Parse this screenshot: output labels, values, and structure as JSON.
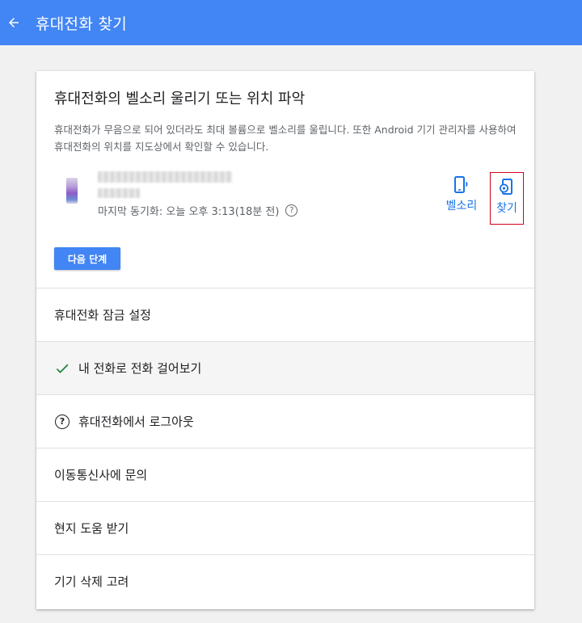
{
  "header": {
    "title": "휴대전화 찾기",
    "back_icon": "arrow-back-icon"
  },
  "card": {
    "heading": "휴대전화의 벨소리 울리기 또는 위치 파악",
    "description": "휴대전화가 무음으로 되어 있더라도 최대 볼륨으로 벨소리를 울립니다. 또한 Android 기기 관리자를 사용하여 휴대전화의 위치를 지도상에서 확인할 수 있습니다."
  },
  "device": {
    "last_sync": "마지막 동기화: 오늘 오후 3:13(18분 전)",
    "help_glyph": "?"
  },
  "actions": {
    "ring_label": "벨소리",
    "find_label": "찾기"
  },
  "next_button": "다음 단계",
  "menu": {
    "items": [
      {
        "label": "휴대전화 잠금 설정"
      },
      {
        "label": "내 전화로 전화 걸어보기",
        "icon": "checkmark-icon"
      },
      {
        "label": "휴대전화에서 로그아웃",
        "icon": "help-circle-icon",
        "icon_glyph": "?"
      },
      {
        "label": "이동통신사에 문의"
      },
      {
        "label": "현지 도움 받기"
      },
      {
        "label": "기기 삭제 고려"
      }
    ]
  },
  "colors": {
    "header_bg": "#4285f4",
    "accent_blue": "#1a73e8",
    "highlight_red": "#d0021b",
    "check_green": "#188038",
    "page_bg": "#f1f1f1"
  }
}
